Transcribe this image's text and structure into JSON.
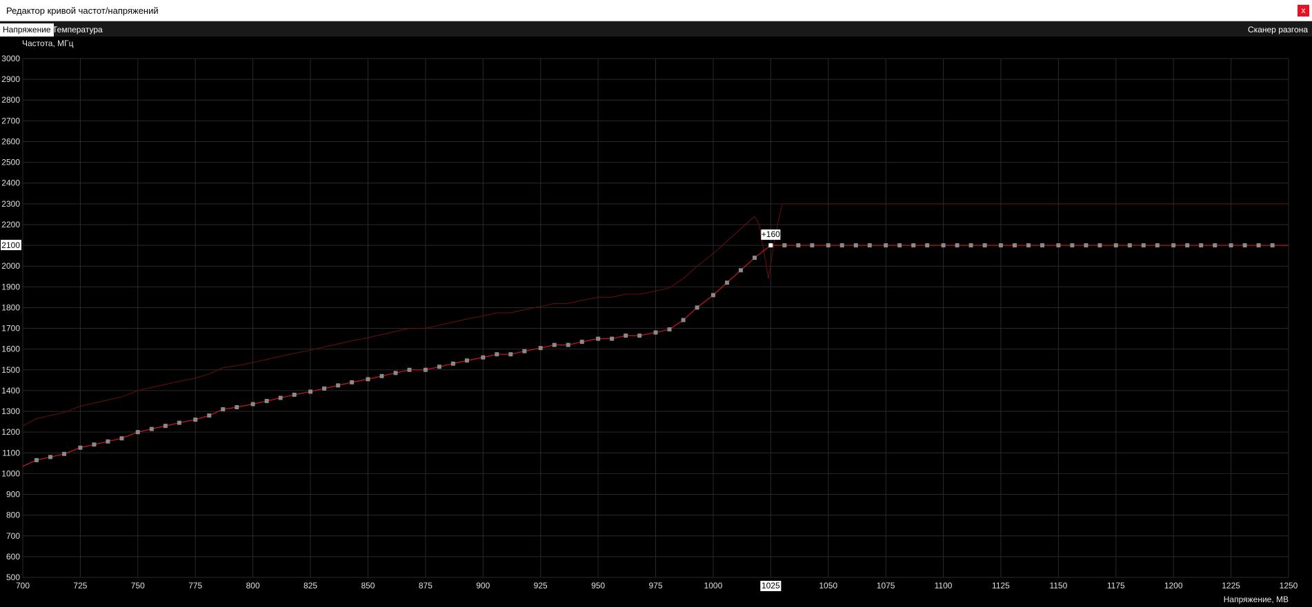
{
  "window": {
    "title": "Редактор кривой частот/напряжений",
    "close_label": "x"
  },
  "tabs": [
    {
      "label": "Напряжение",
      "active": true
    },
    {
      "label": "Температура",
      "active": false
    }
  ],
  "scanner_label": "Сканер разгона",
  "colors": {
    "curve": "#d01818",
    "curve_dim": "#6e0e0e",
    "point": "#8a8a8a",
    "grid": "#2a2a2a",
    "highlight": "#ffffff"
  },
  "chart_data": {
    "type": "line",
    "ylabel": "Частота, МГц",
    "xlabel": "Напряжение, МВ",
    "xlim": [
      700,
      1250
    ],
    "ylim": [
      500,
      3000
    ],
    "x_ticks": [
      700,
      725,
      750,
      775,
      800,
      825,
      850,
      875,
      900,
      925,
      950,
      975,
      1000,
      1025,
      1050,
      1075,
      1100,
      1125,
      1150,
      1175,
      1200,
      1225,
      1250
    ],
    "y_ticks": [
      500,
      600,
      700,
      800,
      900,
      1000,
      1100,
      1200,
      1300,
      1400,
      1500,
      1600,
      1700,
      1800,
      1900,
      2000,
      2100,
      2200,
      2300,
      2400,
      2500,
      2600,
      2700,
      2800,
      2900,
      3000
    ],
    "highlight": {
      "x_label": "1025",
      "y_label": "2100",
      "offset_label": "+160",
      "x": 1025,
      "y": 2100
    },
    "series": [
      {
        "role": "edited-curve",
        "x": [
          700,
          706,
          712,
          718,
          725,
          731,
          737,
          743,
          750,
          756,
          762,
          768,
          775,
          781,
          787,
          793,
          800,
          806,
          812,
          818,
          825,
          831,
          837,
          843,
          850,
          856,
          862,
          868,
          875,
          881,
          887,
          893,
          900,
          906,
          912,
          918,
          925,
          931,
          937,
          943,
          950,
          956,
          962,
          968,
          975,
          981,
          987,
          993,
          1000,
          1006,
          1012,
          1018,
          1025,
          1031,
          1037,
          1043,
          1050,
          1056,
          1062,
          1068,
          1075,
          1081,
          1087,
          1093,
          1100,
          1106,
          1112,
          1118,
          1125,
          1131,
          1137,
          1143,
          1150,
          1156,
          1162,
          1168,
          1175,
          1181,
          1187,
          1193,
          1200,
          1206,
          1212,
          1218,
          1225,
          1231,
          1237,
          1243,
          1250
        ],
        "y": [
          1035,
          1065,
          1080,
          1095,
          1125,
          1140,
          1155,
          1170,
          1200,
          1215,
          1230,
          1245,
          1260,
          1280,
          1310,
          1320,
          1335,
          1350,
          1365,
          1380,
          1395,
          1410,
          1425,
          1440,
          1455,
          1470,
          1485,
          1500,
          1500,
          1515,
          1530,
          1545,
          1560,
          1575,
          1575,
          1590,
          1605,
          1620,
          1620,
          1635,
          1650,
          1650,
          1665,
          1665,
          1680,
          1695,
          1740,
          1800,
          1860,
          1920,
          1980,
          2040,
          2100,
          2100,
          2100,
          2100,
          2100,
          2100,
          2100,
          2100,
          2100,
          2100,
          2100,
          2100,
          2100,
          2100,
          2100,
          2100,
          2100,
          2100,
          2100,
          2100,
          2100,
          2100,
          2100,
          2100,
          2100,
          2100,
          2100,
          2100,
          2100,
          2100,
          2100,
          2100,
          2100,
          2100,
          2100,
          2100,
          2100
        ]
      },
      {
        "role": "original-curve",
        "x": [
          700,
          706,
          712,
          718,
          725,
          731,
          737,
          743,
          750,
          756,
          762,
          768,
          775,
          781,
          787,
          793,
          800,
          806,
          812,
          818,
          825,
          831,
          837,
          843,
          850,
          856,
          862,
          868,
          875,
          881,
          887,
          893,
          900,
          906,
          912,
          918,
          925,
          931,
          937,
          943,
          950,
          956,
          962,
          968,
          975,
          981,
          987,
          993,
          1000,
          1006,
          1012,
          1018,
          1020,
          1024,
          1027,
          1030,
          1050,
          1100,
          1150,
          1200,
          1250
        ],
        "y": [
          1230,
          1265,
          1280,
          1295,
          1325,
          1340,
          1355,
          1370,
          1400,
          1415,
          1430,
          1445,
          1460,
          1480,
          1510,
          1520,
          1535,
          1550,
          1565,
          1580,
          1595,
          1610,
          1625,
          1640,
          1655,
          1670,
          1685,
          1700,
          1700,
          1715,
          1730,
          1745,
          1760,
          1775,
          1775,
          1790,
          1805,
          1820,
          1820,
          1835,
          1850,
          1850,
          1865,
          1865,
          1880,
          1895,
          1940,
          2000,
          2060,
          2120,
          2180,
          2240,
          2200,
          1940,
          2150,
          2300,
          2300,
          2300,
          2300,
          2300,
          2300
        ]
      }
    ]
  }
}
